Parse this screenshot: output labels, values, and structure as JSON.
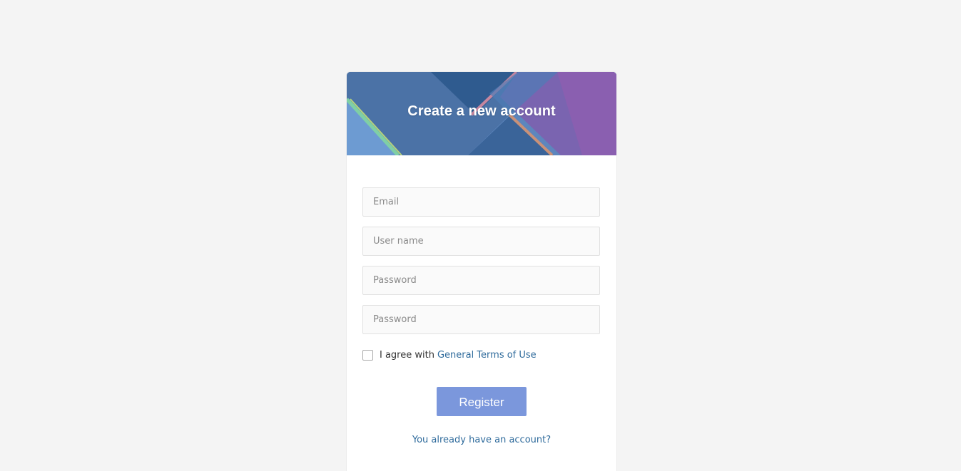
{
  "header": {
    "title": "Create a new account"
  },
  "form": {
    "email_placeholder": "Email",
    "username_placeholder": "User name",
    "password_placeholder": "Password",
    "password_confirm_placeholder": "Password",
    "agree_text": "I agree with",
    "terms_link": "General Terms of Use",
    "agree_checked": false,
    "register_label": "Register",
    "login_link": "You already have an account?"
  },
  "colors": {
    "page_background": "#f4f4f4",
    "header_blue": "#4a72a8",
    "header_purple": "#8a5fb0",
    "button": "#7b97dc",
    "link": "#2f6b9c"
  }
}
